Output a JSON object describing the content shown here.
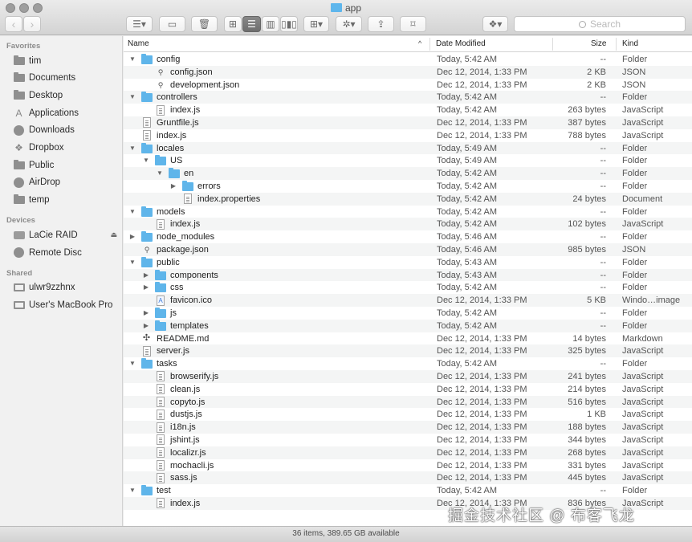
{
  "window": {
    "title": "app",
    "status_text": "36 items, 389.65 GB available",
    "watermark": "掘金技术社区 @ 布客飞龙"
  },
  "toolbar": {
    "back_label": "‹",
    "forward_label": "›",
    "search_placeholder": "Search",
    "view_modes": [
      "icon-view",
      "list-view",
      "column-view",
      "cover-flow-view"
    ],
    "selected_view": "list-view"
  },
  "sidebar": {
    "sections": [
      {
        "heading": "Favorites",
        "items": [
          {
            "label": "tim",
            "icon": "home-icon"
          },
          {
            "label": "Documents",
            "icon": "documents-icon"
          },
          {
            "label": "Desktop",
            "icon": "desktop-icon"
          },
          {
            "label": "Applications",
            "icon": "applications-icon"
          },
          {
            "label": "Downloads",
            "icon": "downloads-icon"
          },
          {
            "label": "Dropbox",
            "icon": "dropbox-icon"
          },
          {
            "label": "Public",
            "icon": "folder-icon"
          },
          {
            "label": "AirDrop",
            "icon": "airdrop-icon"
          },
          {
            "label": "temp",
            "icon": "folder-icon"
          }
        ]
      },
      {
        "heading": "Devices",
        "items": [
          {
            "label": "LaCie RAID",
            "icon": "disk-icon",
            "eject": true
          },
          {
            "label": "Remote Disc",
            "icon": "remote-disc-icon"
          }
        ]
      },
      {
        "heading": "Shared",
        "items": [
          {
            "label": "ulwr9zzhnx",
            "icon": "monitor-icon"
          },
          {
            "label": "User's MacBook Pro",
            "icon": "monitor-icon"
          }
        ]
      }
    ]
  },
  "columns": {
    "name": "Name",
    "date": "Date Modified",
    "size": "Size",
    "kind": "Kind"
  },
  "rows": [
    {
      "name": "config",
      "level": 0,
      "disc": "open",
      "type": "folder",
      "date": "Today, 5:42 AM",
      "size": "--",
      "kind": "Folder"
    },
    {
      "name": "config.json",
      "level": 1,
      "disc": "none",
      "type": "json",
      "date": "Dec 12, 2014, 1:33 PM",
      "size": "2 KB",
      "kind": "JSON"
    },
    {
      "name": "development.json",
      "level": 1,
      "disc": "none",
      "type": "json",
      "date": "Dec 12, 2014, 1:33 PM",
      "size": "2 KB",
      "kind": "JSON"
    },
    {
      "name": "controllers",
      "level": 0,
      "disc": "open",
      "type": "folder",
      "date": "Today, 5:42 AM",
      "size": "--",
      "kind": "Folder"
    },
    {
      "name": "index.js",
      "level": 1,
      "disc": "none",
      "type": "doc",
      "date": "Today, 5:42 AM",
      "size": "263 bytes",
      "kind": "JavaScript"
    },
    {
      "name": "Gruntfile.js",
      "level": 0,
      "disc": "none",
      "type": "doc",
      "date": "Dec 12, 2014, 1:33 PM",
      "size": "387 bytes",
      "kind": "JavaScript"
    },
    {
      "name": "index.js",
      "level": 0,
      "disc": "none",
      "type": "doc",
      "date": "Dec 12, 2014, 1:33 PM",
      "size": "788 bytes",
      "kind": "JavaScript"
    },
    {
      "name": "locales",
      "level": 0,
      "disc": "open",
      "type": "folder",
      "date": "Today, 5:49 AM",
      "size": "--",
      "kind": "Folder"
    },
    {
      "name": "US",
      "level": 1,
      "disc": "open",
      "type": "folder",
      "date": "Today, 5:49 AM",
      "size": "--",
      "kind": "Folder"
    },
    {
      "name": "en",
      "level": 2,
      "disc": "open",
      "type": "folder",
      "date": "Today, 5:42 AM",
      "size": "--",
      "kind": "Folder"
    },
    {
      "name": "errors",
      "level": 3,
      "disc": "closed",
      "type": "folder",
      "date": "Today, 5:42 AM",
      "size": "--",
      "kind": "Folder"
    },
    {
      "name": "index.properties",
      "level": 3,
      "disc": "none",
      "type": "doc",
      "date": "Today, 5:42 AM",
      "size": "24 bytes",
      "kind": "Document"
    },
    {
      "name": "models",
      "level": 0,
      "disc": "open",
      "type": "folder",
      "date": "Today, 5:42 AM",
      "size": "--",
      "kind": "Folder"
    },
    {
      "name": "index.js",
      "level": 1,
      "disc": "none",
      "type": "doc",
      "date": "Today, 5:42 AM",
      "size": "102 bytes",
      "kind": "JavaScript"
    },
    {
      "name": "node_modules",
      "level": 0,
      "disc": "closed",
      "type": "folder",
      "date": "Today, 5:46 AM",
      "size": "--",
      "kind": "Folder"
    },
    {
      "name": "package.json",
      "level": 0,
      "disc": "none",
      "type": "json",
      "date": "Today, 5:46 AM",
      "size": "985 bytes",
      "kind": "JSON"
    },
    {
      "name": "public",
      "level": 0,
      "disc": "open",
      "type": "folder",
      "date": "Today, 5:43 AM",
      "size": "--",
      "kind": "Folder"
    },
    {
      "name": "components",
      "level": 1,
      "disc": "closed",
      "type": "folder",
      "date": "Today, 5:43 AM",
      "size": "--",
      "kind": "Folder"
    },
    {
      "name": "css",
      "level": 1,
      "disc": "closed",
      "type": "folder",
      "date": "Today, 5:42 AM",
      "size": "--",
      "kind": "Folder"
    },
    {
      "name": "favicon.ico",
      "level": 1,
      "disc": "none",
      "type": "ico",
      "date": "Dec 12, 2014, 1:33 PM",
      "size": "5 KB",
      "kind": "Windo…image"
    },
    {
      "name": "js",
      "level": 1,
      "disc": "closed",
      "type": "folder",
      "date": "Today, 5:42 AM",
      "size": "--",
      "kind": "Folder"
    },
    {
      "name": "templates",
      "level": 1,
      "disc": "closed",
      "type": "folder",
      "date": "Today, 5:42 AM",
      "size": "--",
      "kind": "Folder"
    },
    {
      "name": "README.md",
      "level": 0,
      "disc": "none",
      "type": "md",
      "date": "Dec 12, 2014, 1:33 PM",
      "size": "14 bytes",
      "kind": "Markdown"
    },
    {
      "name": "server.js",
      "level": 0,
      "disc": "none",
      "type": "doc",
      "date": "Dec 12, 2014, 1:33 PM",
      "size": "325 bytes",
      "kind": "JavaScript"
    },
    {
      "name": "tasks",
      "level": 0,
      "disc": "open",
      "type": "folder",
      "date": "Today, 5:42 AM",
      "size": "--",
      "kind": "Folder"
    },
    {
      "name": "browserify.js",
      "level": 1,
      "disc": "none",
      "type": "doc",
      "date": "Dec 12, 2014, 1:33 PM",
      "size": "241 bytes",
      "kind": "JavaScript"
    },
    {
      "name": "clean.js",
      "level": 1,
      "disc": "none",
      "type": "doc",
      "date": "Dec 12, 2014, 1:33 PM",
      "size": "214 bytes",
      "kind": "JavaScript"
    },
    {
      "name": "copyto.js",
      "level": 1,
      "disc": "none",
      "type": "doc",
      "date": "Dec 12, 2014, 1:33 PM",
      "size": "516 bytes",
      "kind": "JavaScript"
    },
    {
      "name": "dustjs.js",
      "level": 1,
      "disc": "none",
      "type": "doc",
      "date": "Dec 12, 2014, 1:33 PM",
      "size": "1 KB",
      "kind": "JavaScript"
    },
    {
      "name": "i18n.js",
      "level": 1,
      "disc": "none",
      "type": "doc",
      "date": "Dec 12, 2014, 1:33 PM",
      "size": "188 bytes",
      "kind": "JavaScript"
    },
    {
      "name": "jshint.js",
      "level": 1,
      "disc": "none",
      "type": "doc",
      "date": "Dec 12, 2014, 1:33 PM",
      "size": "344 bytes",
      "kind": "JavaScript"
    },
    {
      "name": "localizr.js",
      "level": 1,
      "disc": "none",
      "type": "doc",
      "date": "Dec 12, 2014, 1:33 PM",
      "size": "268 bytes",
      "kind": "JavaScript"
    },
    {
      "name": "mochacli.js",
      "level": 1,
      "disc": "none",
      "type": "doc",
      "date": "Dec 12, 2014, 1:33 PM",
      "size": "331 bytes",
      "kind": "JavaScript"
    },
    {
      "name": "sass.js",
      "level": 1,
      "disc": "none",
      "type": "doc",
      "date": "Dec 12, 2014, 1:33 PM",
      "size": "445 bytes",
      "kind": "JavaScript"
    },
    {
      "name": "test",
      "level": 0,
      "disc": "open",
      "type": "folder",
      "date": "Today, 5:42 AM",
      "size": "--",
      "kind": "Folder"
    },
    {
      "name": "index.js",
      "level": 1,
      "disc": "none",
      "type": "doc",
      "date": "Dec 12, 2014, 1:33 PM",
      "size": "836 bytes",
      "kind": "JavaScript"
    }
  ]
}
